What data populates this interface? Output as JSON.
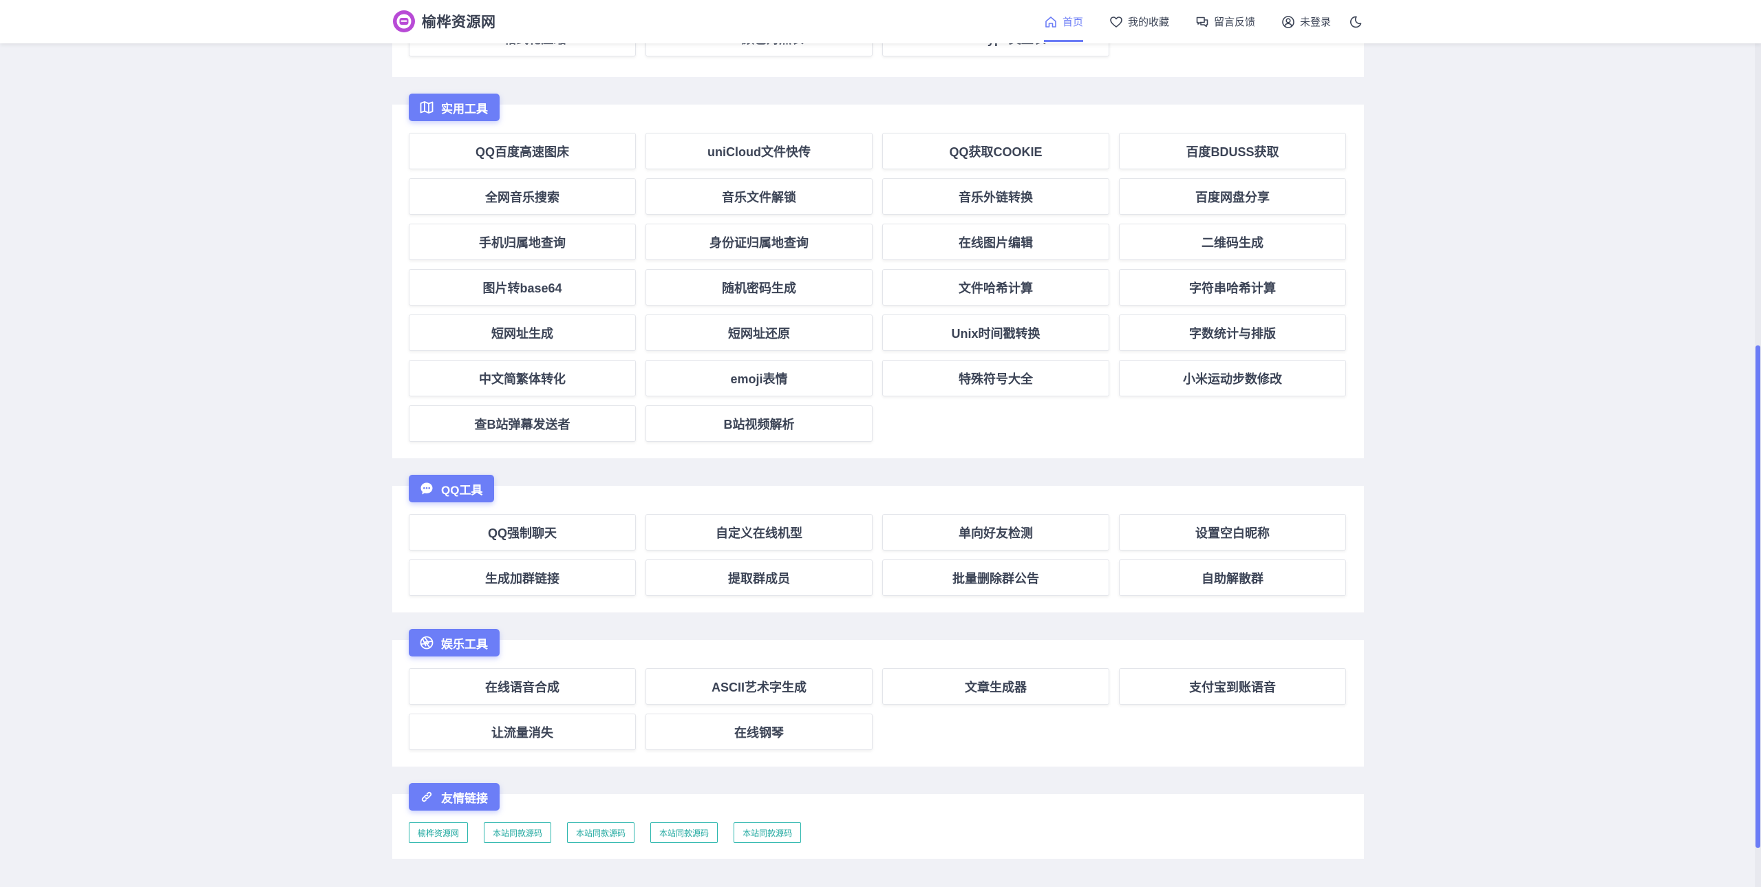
{
  "site": {
    "name": "榆桦资源网"
  },
  "nav": [
    {
      "label": "首页",
      "icon": "home-icon"
    },
    {
      "label": "我的收藏",
      "icon": "heart-icon"
    },
    {
      "label": "留言反馈",
      "icon": "chat-icon"
    },
    {
      "label": "未登录",
      "icon": "user-icon"
    }
  ],
  "theme_toggle_icon": "moon-icon",
  "top_partial": {
    "items": [
      "CSS格式化压缩",
      "RGB颜色对照表",
      "Mime Type类型表"
    ]
  },
  "sections": [
    {
      "title": "实用工具",
      "icon": "map-icon",
      "items": [
        "QQ百度高速图床",
        "uniCloud文件快传",
        "QQ获取COOKIE",
        "百度BDUSS获取",
        "全网音乐搜索",
        "音乐文件解锁",
        "音乐外链转换",
        "百度网盘分享",
        "手机归属地查询",
        "身份证归属地查询",
        "在线图片编辑",
        "二维码生成",
        "图片转base64",
        "随机密码生成",
        "文件哈希计算",
        "字符串哈希计算",
        "短网址生成",
        "短网址还原",
        "Unix时间戳转换",
        "字数统计与排版",
        "中文简繁体转化",
        "emoji表情",
        "特殊符号大全",
        "小米运动步数修改",
        "查B站弹幕发送者",
        "B站视频解析"
      ]
    },
    {
      "title": "QQ工具",
      "icon": "message-bubble-icon",
      "items": [
        "QQ强制聊天",
        "自定义在线机型",
        "单向好友检测",
        "设置空白昵称",
        "生成加群链接",
        "提取群成员",
        "批量删除群公告",
        "自助解散群"
      ]
    },
    {
      "title": "娱乐工具",
      "icon": "aperture-icon",
      "items": [
        "在线语音合成",
        "ASCII艺术字生成",
        "文章生成器",
        "支付宝到账语音",
        "让流量消失",
        "在线钢琴"
      ]
    }
  ],
  "friend_links": {
    "title": "友情链接",
    "icon": "link-icon",
    "items": [
      "榆桦资源网",
      "本站同款源码",
      "本站同款源码",
      "本站同款源码",
      "本站同款源码"
    ]
  },
  "colors": {
    "accent": "#6c7ef7",
    "link": "#1fa89f",
    "background": "#f0f1f6"
  }
}
